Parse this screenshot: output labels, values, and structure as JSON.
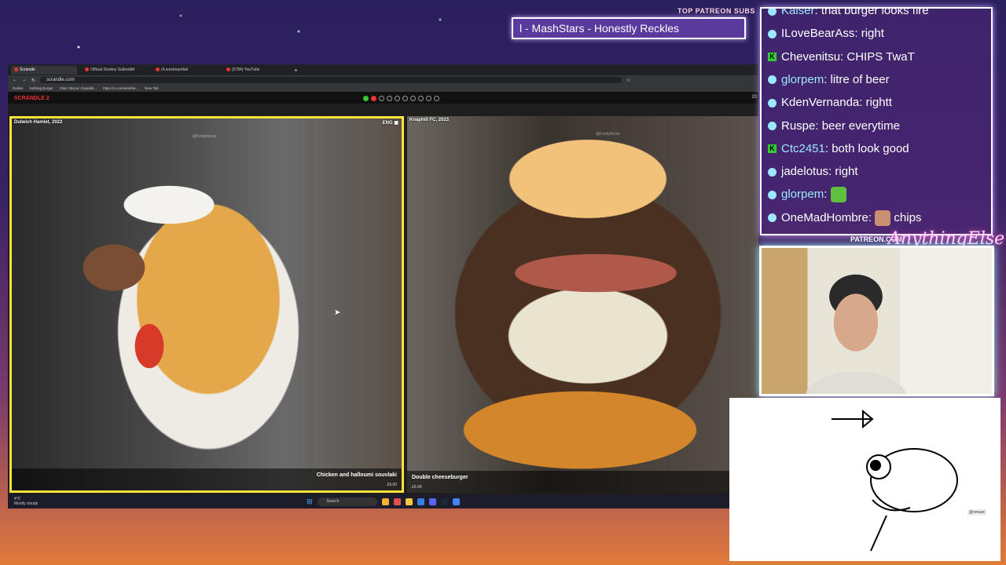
{
  "ticker": {
    "label": "TOP PATREON SUBS",
    "text": "l - MashStars - Honestly Reckles"
  },
  "browser": {
    "tabs": [
      {
        "label": "Scrandle",
        "active": true
      },
      {
        "label": "Official Destiny Subreddit"
      },
      {
        "label": "r/Livestreamfail"
      },
      {
        "label": "(5784) YouTube"
      }
    ],
    "url": "scrandle.com",
    "bookmarks": [
      "Dailies",
      "Nothing Burger",
      "Clair Obscur: Expediti...",
      "https://x.com/asmitte...",
      "New Tab"
    ]
  },
  "app": {
    "logo": "SCRANDLE 2",
    "progress_dots": [
      "green",
      "red",
      "empty",
      "empty",
      "empty",
      "empty",
      "empty",
      "empty",
      "empty",
      "empty"
    ],
    "year_label": "20"
  },
  "left_option": {
    "source": "Dulwich Hamlet, 2022",
    "country": "ENG",
    "name": "Chicken and halloumi souvlaki",
    "price": "£9.00",
    "watermark": "@FootyScran",
    "selected": true
  },
  "right_option": {
    "source": "Knaphill FC, 2023",
    "name": "Double cheeseburger",
    "price": "£6.00",
    "watermark": "@FootyScran"
  },
  "taskbar": {
    "temp": "4°C",
    "weather": "Mostly cloudy",
    "search": "Search"
  },
  "chat": [
    {
      "user": "Kaiser",
      "text": "that burger looks fire",
      "badge": "b",
      "user_color": "blue"
    },
    {
      "user": "ILoveBearAss",
      "text": "right",
      "badge": "b"
    },
    {
      "user": "Chevenitsu",
      "text": "CHIPS TwaT",
      "badge": "k"
    },
    {
      "user": "glorpem",
      "text": "litre of beer",
      "badge": "b",
      "user_color": "blue"
    },
    {
      "user": "KdenVernanda",
      "text": "rightt",
      "badge": "b"
    },
    {
      "user": "Ruspe",
      "text": "beer everytime",
      "badge": "b"
    },
    {
      "user": "Ctc2451",
      "text": "both look good",
      "badge": "k",
      "user_color": "blue"
    },
    {
      "user": "jadelotus",
      "text": "right",
      "badge": "b"
    },
    {
      "user": "glorpem",
      "text": "",
      "badge": "b",
      "user_color": "blue",
      "emote": "#5fbf3f"
    },
    {
      "user": "OneMadHombre",
      "text": "chips",
      "badge": "b",
      "emote": "#c89070"
    }
  ],
  "patreon_sign": "PATREON.COM/",
  "neon_sign": "AnythingElse",
  "drawing_tag": "@nmaze"
}
